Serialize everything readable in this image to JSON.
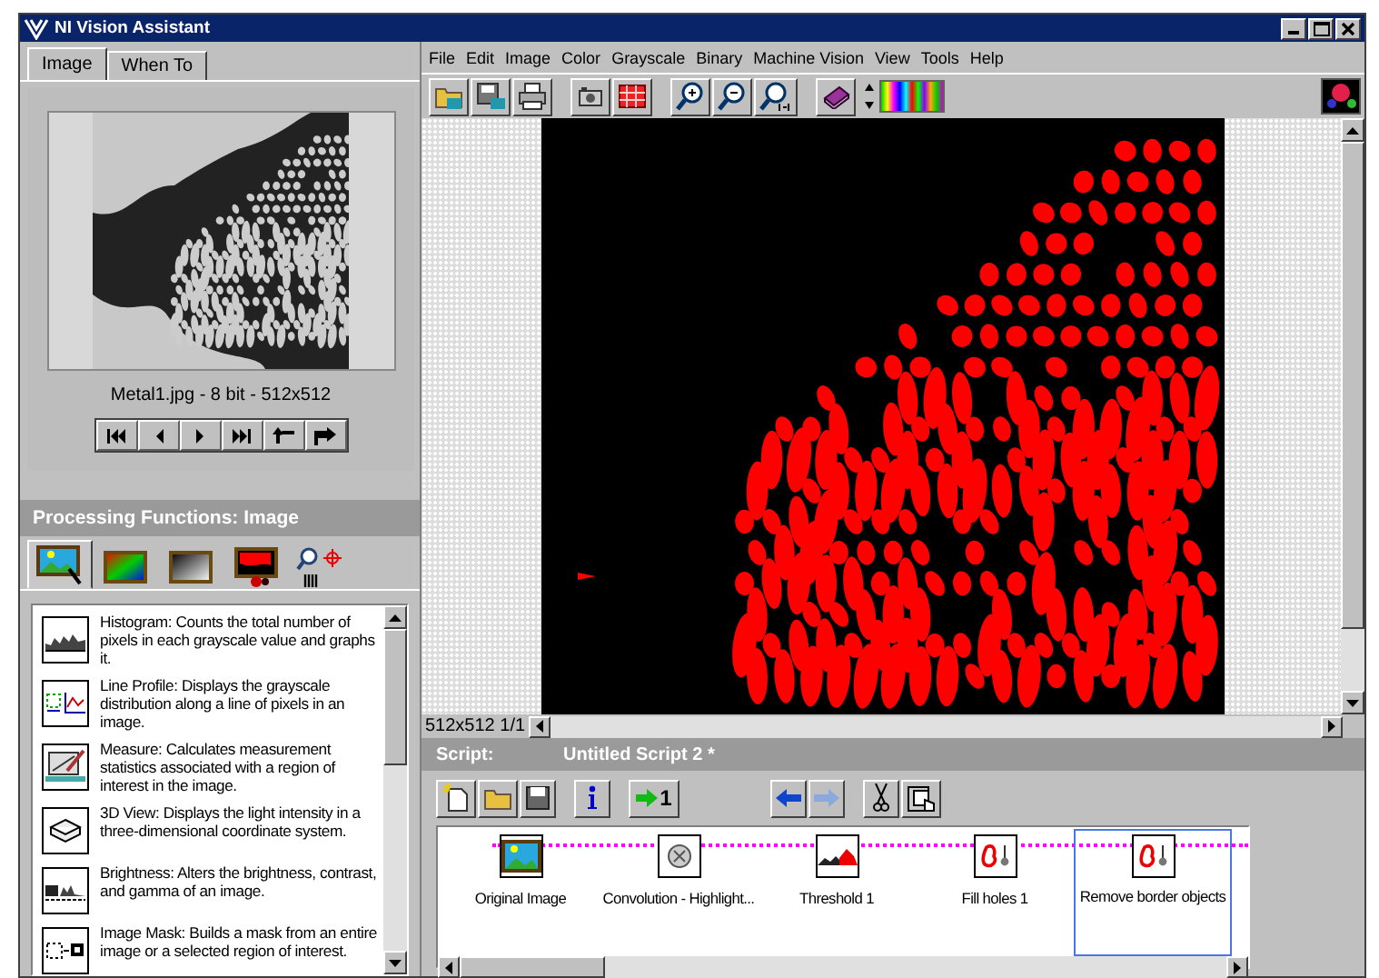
{
  "window": {
    "title": "NI Vision Assistant"
  },
  "left_tabs": [
    {
      "label": "Image",
      "selected": true
    },
    {
      "label": "When To",
      "selected": false
    }
  ],
  "image_caption": "Metal1.jpg - 8 bit - 512x512",
  "processing": {
    "title": "Processing Functions: Image",
    "categories": [
      {
        "kind": "image",
        "selected": true
      },
      {
        "kind": "color",
        "selected": false
      },
      {
        "kind": "grayscale",
        "selected": false
      },
      {
        "kind": "binary",
        "selected": false
      },
      {
        "kind": "machine_vision",
        "selected": false
      }
    ],
    "functions": [
      {
        "kind": "histogram",
        "text": "Histogram:  Counts the total number of pixels in each grayscale value and graphs it."
      },
      {
        "kind": "line_profile",
        "text": "Line Profile:  Displays the grayscale distribution along a line of pixels in an image."
      },
      {
        "kind": "measure",
        "text": "Measure:  Calculates measurement statistics associated with a region of interest in the image."
      },
      {
        "kind": "view3d",
        "text": "3D View:  Displays the light intensity in a three-dimensional coordinate system."
      },
      {
        "kind": "brightness",
        "text": "Brightness:  Alters the brightness, contrast, and gamma of an image."
      },
      {
        "kind": "mask",
        "text": "Image Mask:  Builds a mask from an entire image or a selected region of interest."
      }
    ]
  },
  "menu": [
    "File",
    "Edit",
    "Image",
    "Color",
    "Grayscale",
    "Binary",
    "Machine Vision",
    "View",
    "Tools",
    "Help"
  ],
  "status": "512x512 1/1",
  "script": {
    "label": "Script:",
    "title": "Untitled Script 2 *",
    "run_to_label": "1",
    "steps": [
      {
        "kind": "image",
        "label": "Original Image",
        "selected": false
      },
      {
        "kind": "convolution",
        "label": "Convolution - Highlight...",
        "selected": false
      },
      {
        "kind": "threshold",
        "label": "Threshold 1",
        "selected": false
      },
      {
        "kind": "particle",
        "label": "Fill holes 1",
        "selected": false
      },
      {
        "kind": "particle",
        "label": "Remove border objects",
        "selected": true
      }
    ]
  }
}
